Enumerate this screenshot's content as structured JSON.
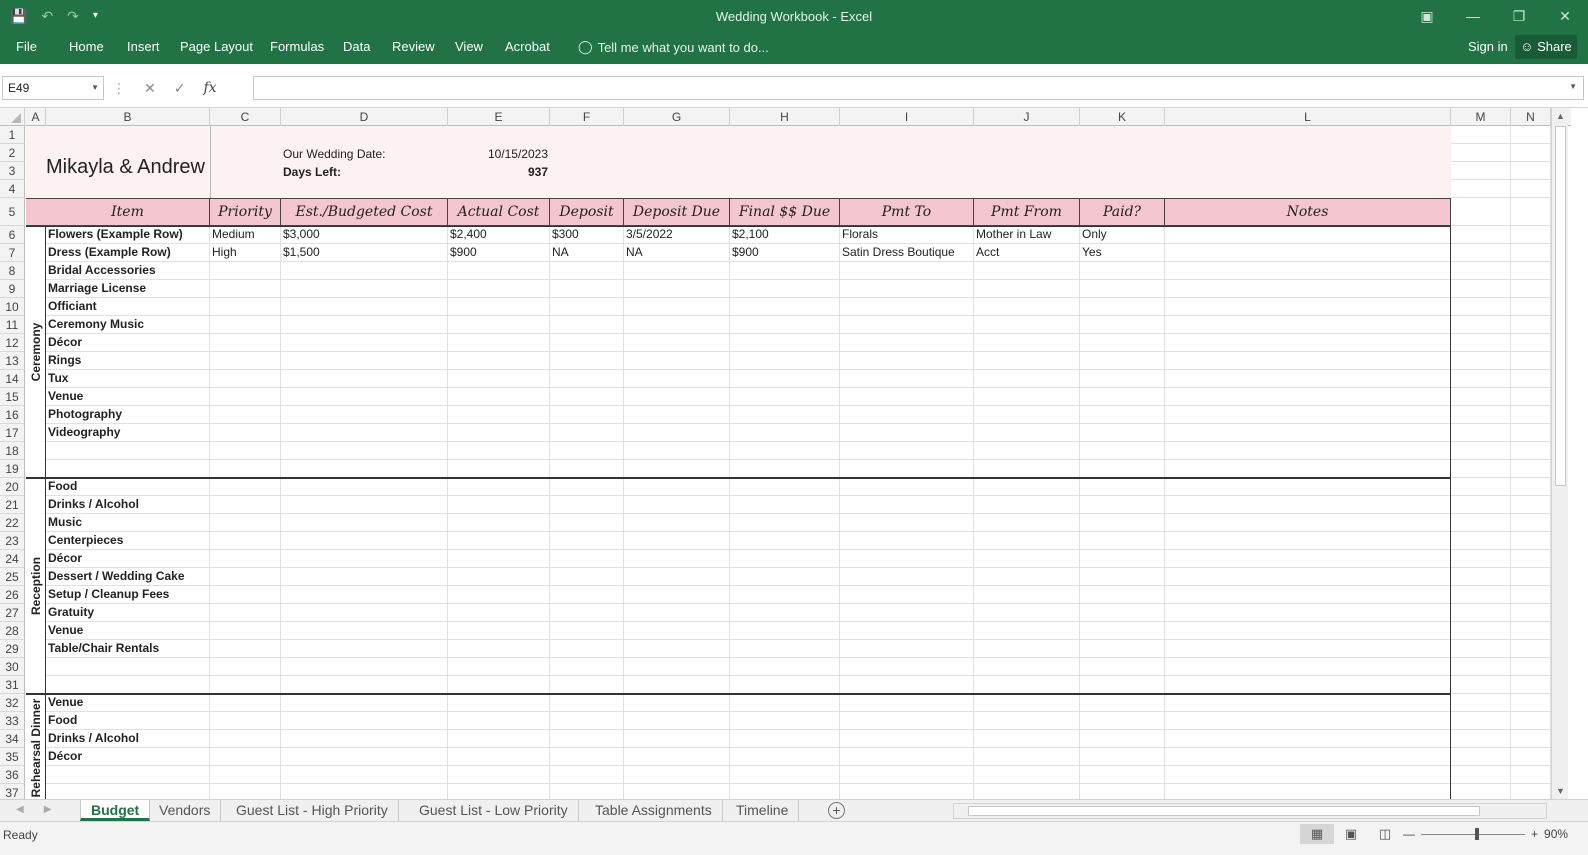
{
  "window": {
    "title": "Wedding Workbook - Excel"
  },
  "ribbon": {
    "tabs": [
      "File",
      "Home",
      "Insert",
      "Page Layout",
      "Formulas",
      "Data",
      "Review",
      "View",
      "Acrobat"
    ],
    "tell_me": "Tell me what you want to do...",
    "sign_in": "Sign in",
    "share": "Share"
  },
  "formula_bar": {
    "name_box": "E49",
    "formula": ""
  },
  "columns": [
    "A",
    "B",
    "C",
    "D",
    "E",
    "F",
    "G",
    "H",
    "I",
    "J",
    "K",
    "L",
    "M",
    "N"
  ],
  "rows": [
    "1",
    "2",
    "3",
    "4",
    "5",
    "6",
    "7",
    "8",
    "9",
    "10",
    "11",
    "12",
    "13",
    "14",
    "15",
    "16",
    "17",
    "18",
    "19",
    "20",
    "21",
    "22",
    "23",
    "24",
    "25",
    "26",
    "27",
    "28",
    "29",
    "30",
    "31",
    "32",
    "33",
    "34",
    "35",
    "36",
    "37"
  ],
  "sheet": {
    "couple": "Mikayla & Andrew",
    "wedding_date_label": "Our Wedding Date:",
    "wedding_date": "10/15/2023",
    "days_left_label": "Days Left:",
    "days_left": "937",
    "headers": [
      "Item",
      "Priority",
      "Est./Budgeted Cost",
      "Actual Cost",
      "Deposit",
      "Deposit Due",
      "Final $$ Due",
      "Pmt To",
      "Pmt From",
      "Paid?",
      "Notes"
    ],
    "sections": [
      {
        "label": "Ceremony",
        "items": [
          "Flowers (Example Row)",
          "Dress (Example Row)",
          "Bridal Accessories",
          "Marriage License",
          "Officiant",
          "Ceremony Music",
          "Décor",
          "Rings",
          "Tux",
          "Venue",
          "Photography",
          "Videography",
          "",
          ""
        ]
      },
      {
        "label": "Reception",
        "items": [
          "Food",
          "Drinks / Alcohol",
          "Music",
          "Centerpieces",
          "Décor",
          "Dessert / Wedding Cake",
          "Setup / Cleanup Fees",
          "Gratuity",
          "Venue",
          "Table/Chair Rentals",
          "",
          ""
        ]
      },
      {
        "label": "Rehearsal Dinner",
        "items": [
          "Venue",
          "Food",
          "Drinks / Alcohol",
          "Décor",
          "",
          ""
        ]
      }
    ],
    "example_rows": [
      {
        "priority": "Medium",
        "est": "$3,000",
        "actual": "$2,400",
        "deposit": "$300",
        "deposit_due": "3/5/2022",
        "final_due": "$2,100",
        "pmt_to": "Florals",
        "pmt_from": "Mother in Law",
        "paid": "Only",
        "notes": ""
      },
      {
        "priority": "High",
        "est": "$1,500",
        "actual": "$900",
        "deposit": "NA",
        "deposit_due": "NA",
        "final_due": "$900",
        "pmt_to": "Satin Dress Boutique",
        "pmt_from": "Acct",
        "paid": "Yes",
        "notes": ""
      }
    ]
  },
  "sheet_tabs": [
    "Budget",
    "Vendors",
    "Guest List - High Priority",
    "Guest List - Low Priority",
    "Table Assignments",
    "Timeline"
  ],
  "active_sheet": "Budget",
  "status": {
    "ready": "Ready",
    "zoom": "90%"
  }
}
